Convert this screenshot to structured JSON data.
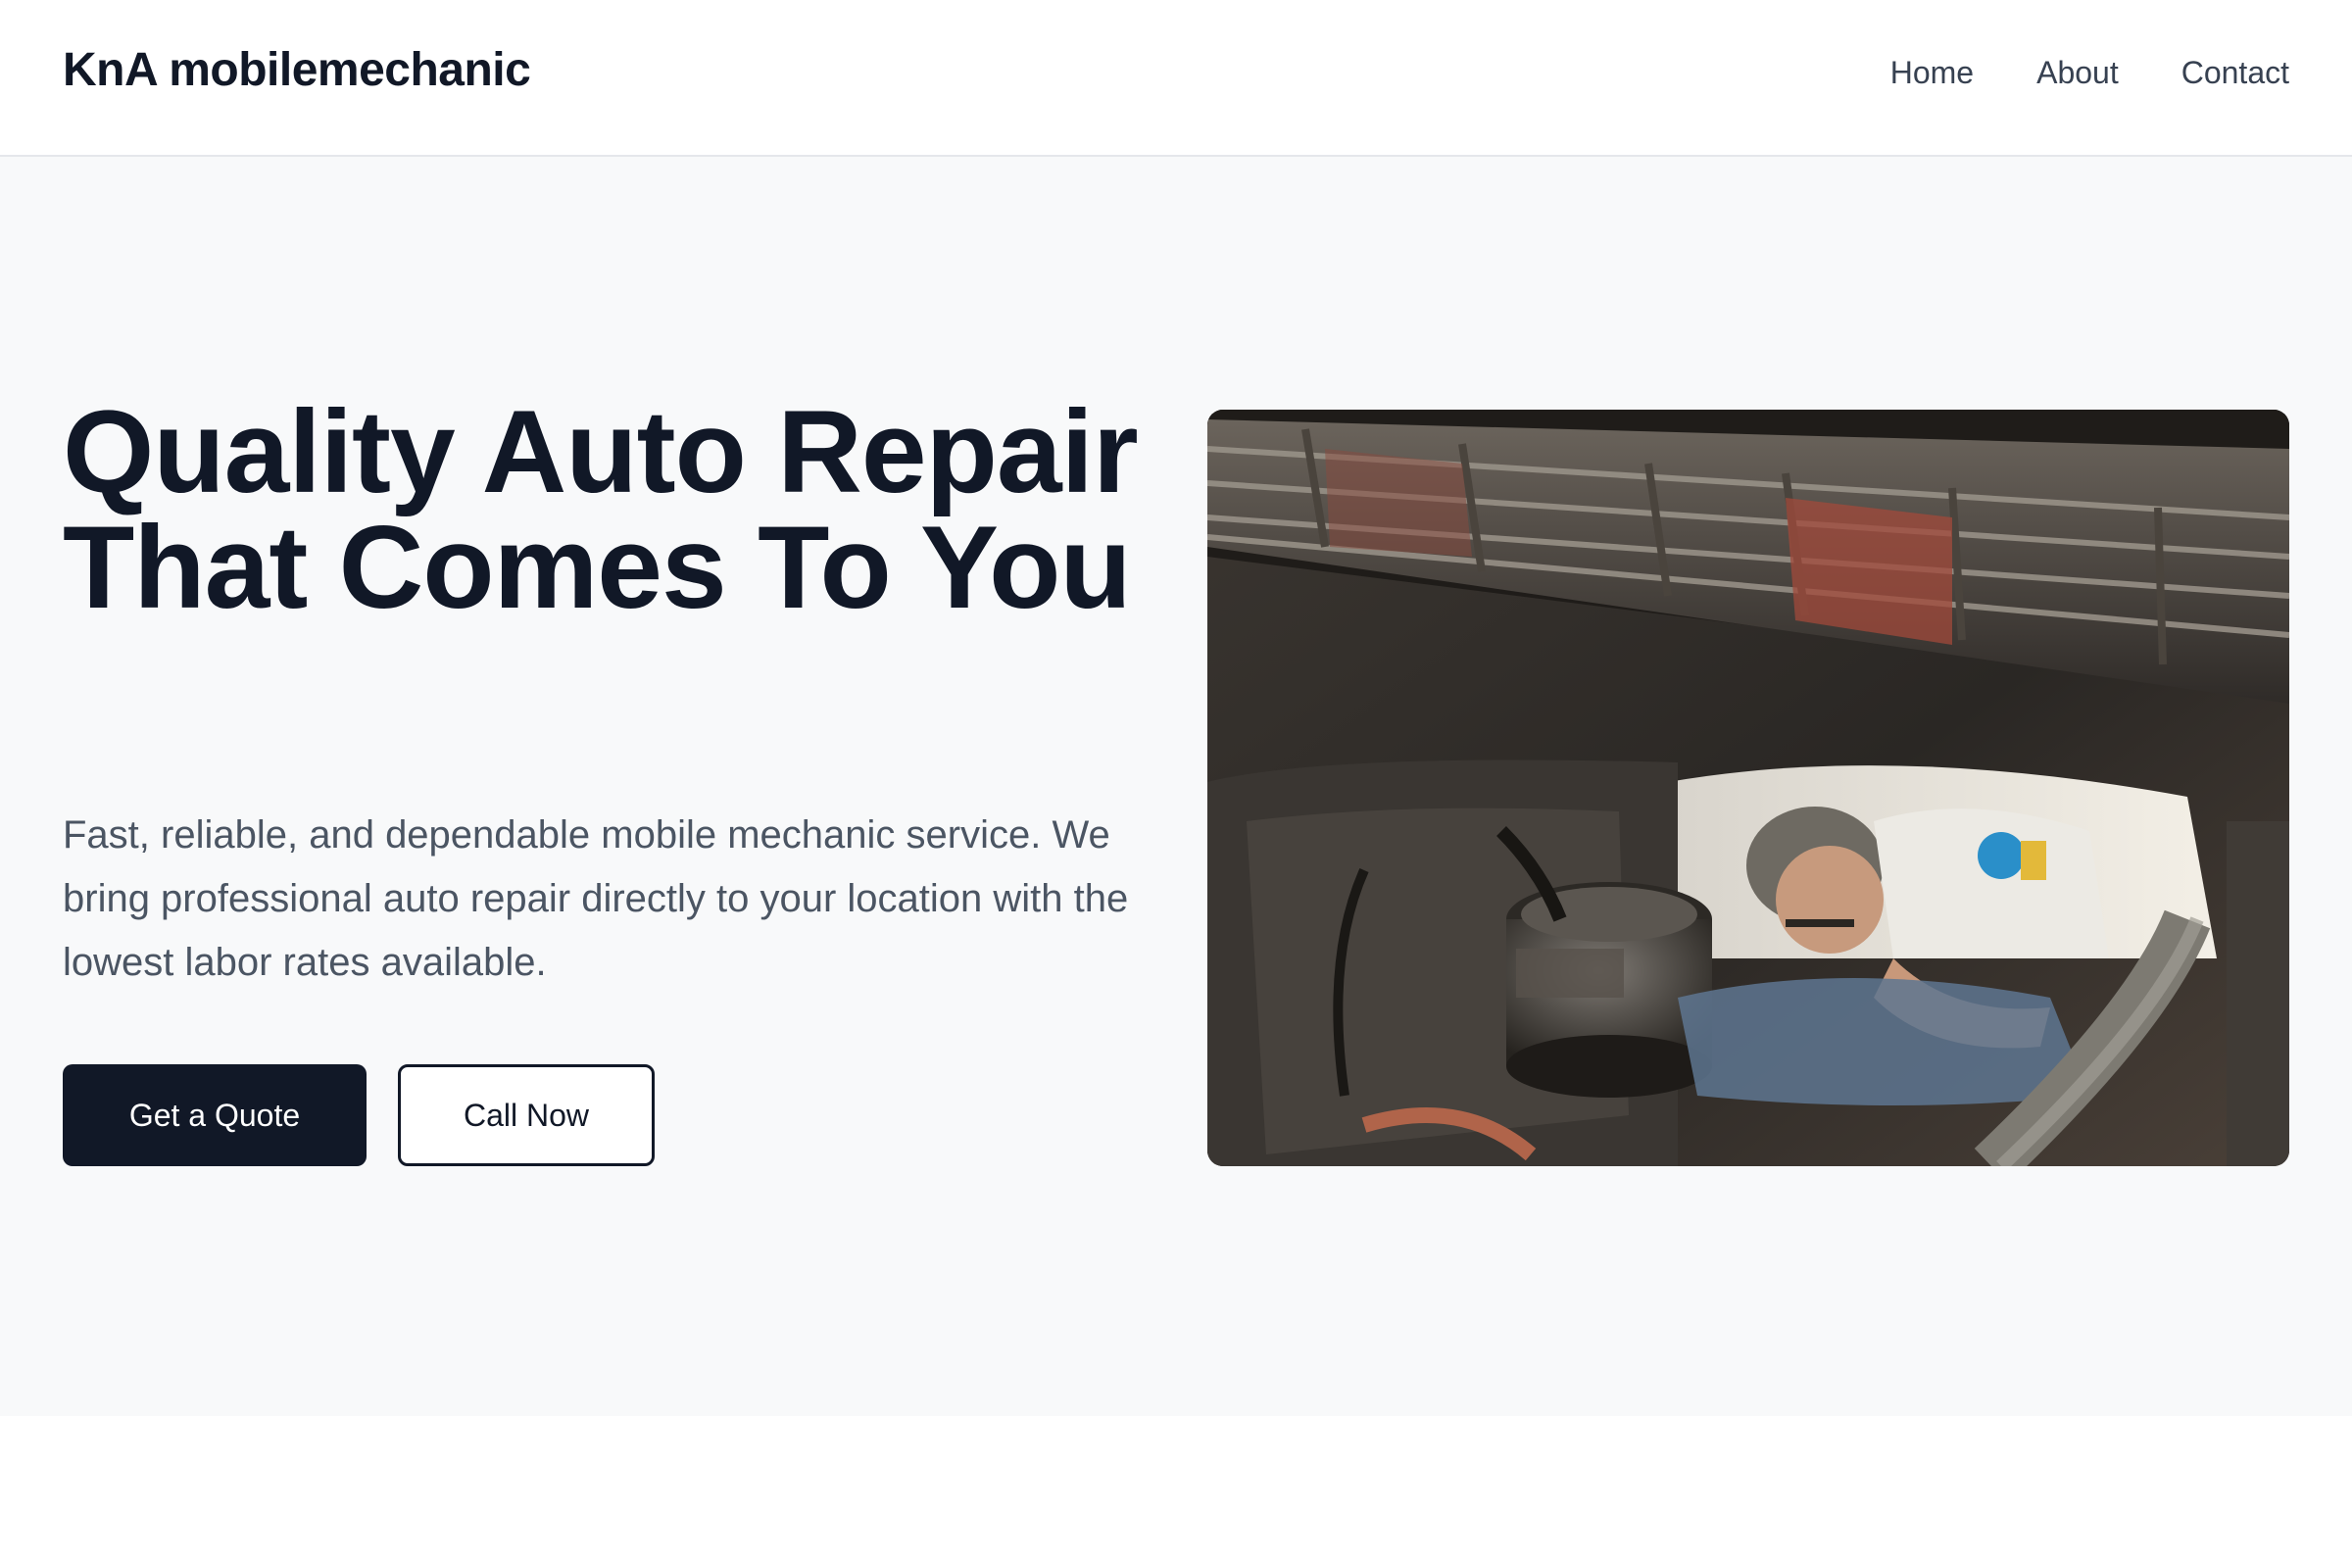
{
  "header": {
    "brand": "KnA mobilemechanic",
    "nav": [
      {
        "label": "Home"
      },
      {
        "label": "About"
      },
      {
        "label": "Contact"
      }
    ]
  },
  "hero": {
    "title": "Quality Auto Repair That Comes To You",
    "subtitle": "Fast, reliable, and dependable mobile mechanic service. We bring professional auto repair directly to your location with the lowest labor rates available.",
    "primary_button": "Get a Quote",
    "secondary_button": "Call Now",
    "image": {
      "subject": "mechanic inspecting an engine under a car hood"
    }
  },
  "colors": {
    "primary": "#111827",
    "text_muted": "#4b5563",
    "hero_background": "#f8f9fa",
    "border": "#e5e7eb"
  }
}
